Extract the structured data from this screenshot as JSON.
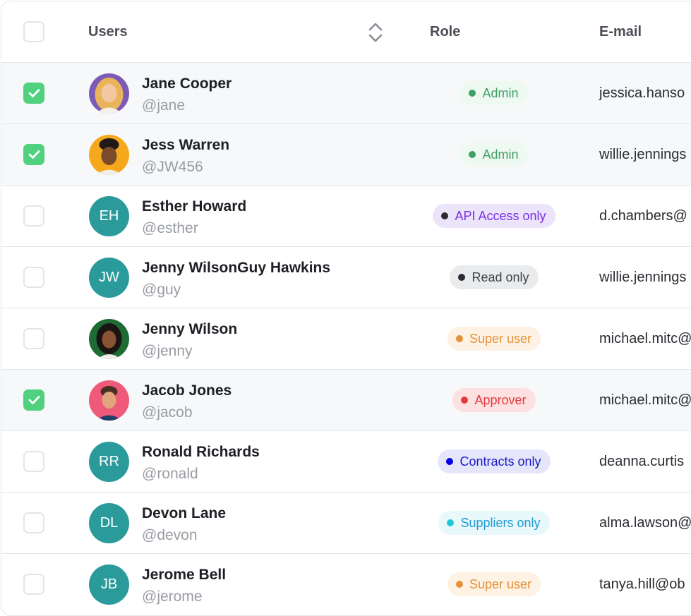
{
  "header": {
    "users_label": "Users",
    "role_label": "Role",
    "email_label": "E-mail",
    "sort_icon": "chevron-up-down-icon"
  },
  "colors": {
    "checkbox_checked": "#4fd17e",
    "avatar_initials_bg": "#2a9a9b",
    "selected_row_bg": "#f7f8fa"
  },
  "users": [
    {
      "name": "Jane Cooper",
      "handle": "@jane",
      "role": "Admin",
      "email": "jessica.hanso",
      "checked": true,
      "avatar_initials": ""
    },
    {
      "name": "Jess Warren",
      "handle": "@JW456",
      "role": "Admin",
      "email": "willie.jennings",
      "checked": true,
      "avatar_initials": ""
    },
    {
      "name": "Esther Howard",
      "handle": "@esther",
      "role": "API Access only",
      "email": "d.chambers@",
      "checked": false,
      "avatar_initials": "EH"
    },
    {
      "name": "Jenny WilsonGuy Hawkins",
      "handle": "@guy",
      "role": "Read only",
      "email": "willie.jennings",
      "checked": false,
      "avatar_initials": "JW"
    },
    {
      "name": "Jenny Wilson",
      "handle": "@jenny",
      "role": "Super user",
      "email": "michael.mitc@",
      "checked": false,
      "avatar_initials": ""
    },
    {
      "name": "Jacob Jones",
      "handle": "@jacob",
      "role": "Approver",
      "email": "michael.mitc@",
      "checked": true,
      "avatar_initials": ""
    },
    {
      "name": "Ronald Richards",
      "handle": "@ronald",
      "role": "Contracts only",
      "email": "deanna.curtis",
      "checked": false,
      "avatar_initials": "RR"
    },
    {
      "name": "Devon Lane",
      "handle": "@devon",
      "role": "Suppliers only",
      "email": "alma.lawson@",
      "checked": false,
      "avatar_initials": "DL"
    },
    {
      "name": "Jerome Bell",
      "handle": "@jerome",
      "role": "Super user",
      "email": "tanya.hill@ob",
      "checked": false,
      "avatar_initials": "JB"
    }
  ]
}
